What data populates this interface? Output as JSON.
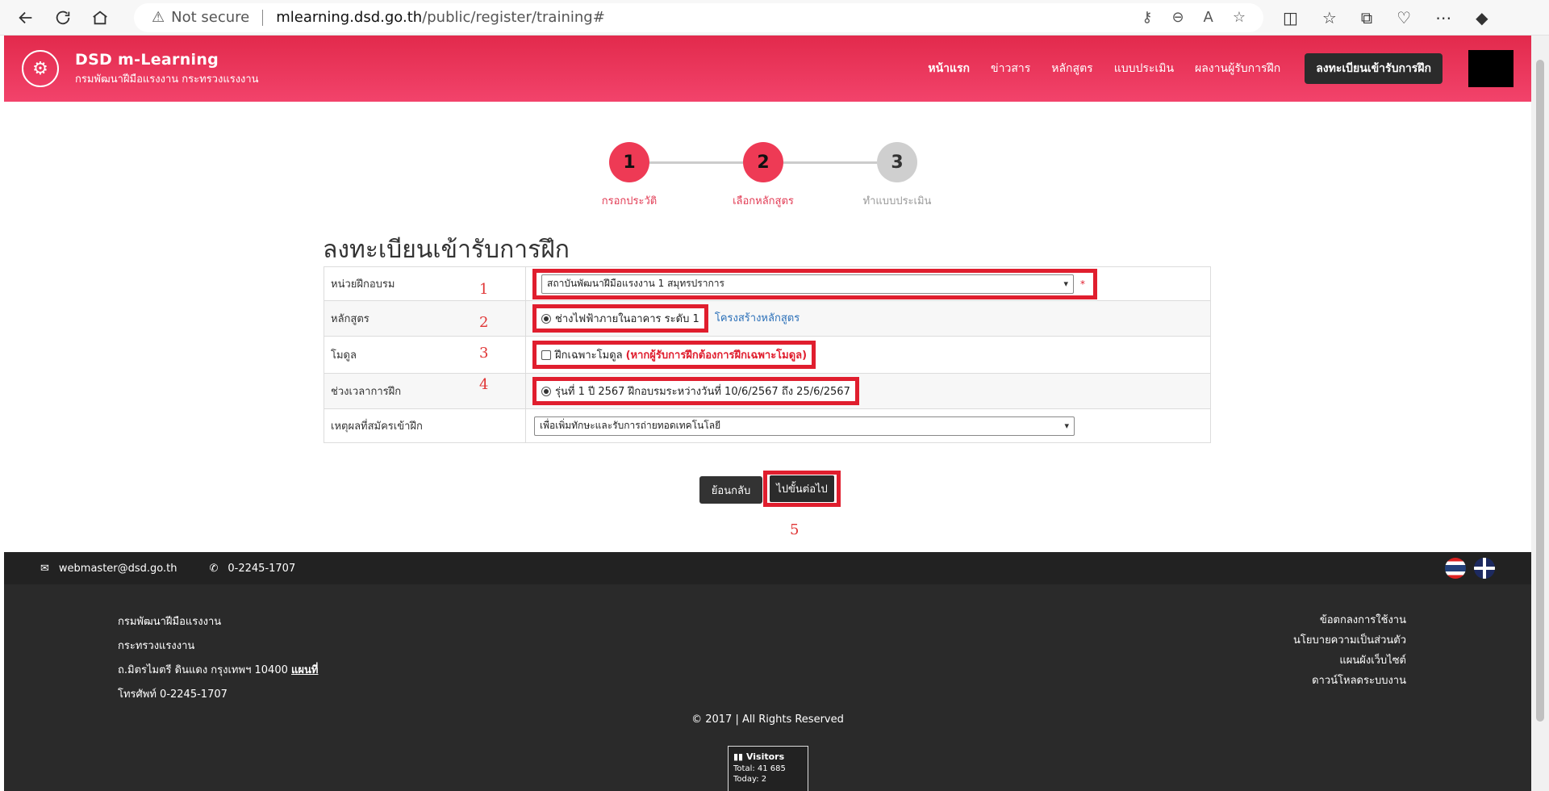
{
  "browser": {
    "security_label": "Not secure",
    "url_host": "mlearning.dsd.go.th",
    "url_path": "/public/register/training#"
  },
  "header": {
    "brand_title": "DSD m-Learning",
    "brand_subtitle": "กรมพัฒนาฝีมือแรงงาน กระทรวงแรงงาน",
    "menu": [
      "หน้าแรก",
      "ข่าวสาร",
      "หลักสูตร",
      "แบบประเมิน",
      "ผลงานผู้รับการฝึก"
    ],
    "register_button": "ลงทะเบียนเข้ารับการฝึก"
  },
  "steps": [
    {
      "number": "1",
      "label": "กรอกประวัติ",
      "state": "done"
    },
    {
      "number": "2",
      "label": "เลือกหลักสูตร",
      "state": "done"
    },
    {
      "number": "3",
      "label": "ทำแบบประเมิน",
      "state": "todo"
    }
  ],
  "form": {
    "title": "ลงทะเบียนเข้ารับการฝึก",
    "rows": {
      "unit_label": "หน่วยฝึกอบรม",
      "unit_value": "สถาบันพัฒนาฝีมือแรงงาน 1 สมุทรปราการ",
      "required_mark": "*",
      "course_label": "หลักสูตร",
      "course_value": "ช่างไฟฟ้าภายในอาคาร ระดับ 1",
      "course_link": "โครงสร้างหลักสูตร",
      "module_label": "โมดูล",
      "module_value": "ฝึกเฉพาะโมดูล",
      "module_note": "(หากผู้รับการฝึกต้องการฝึกเฉพาะโมดูล)",
      "period_label": "ช่วงเวลาการฝึก",
      "period_value": "รุ่นที่ 1 ปี 2567 ฝึกอบรมระหว่างวันที่ 10/6/2567 ถึง 25/6/2567",
      "reason_label": "เหตุผลที่สมัครเข้าฝึก",
      "reason_value": "เพื่อเพิ่มทักษะและรับการถ่ายทอดเทคโนโลยี"
    },
    "annotations": [
      "1",
      "2",
      "3",
      "4",
      "5"
    ],
    "back_button": "ย้อนกลับ",
    "next_button": "ไปขั้นต่อไป"
  },
  "footer": {
    "email": "webmaster@dsd.go.th",
    "phone": "0-2245-1707",
    "org_lines": [
      "กรมพัฒนาฝีมือแรงงาน",
      "กระทรวงแรงงาน",
      "ถ.มิตรไมตรี ดินแดง กรุงเทพฯ 10400",
      "โทรศัพท์ 0-2245-1707"
    ],
    "map_link": "แผนที่",
    "links": [
      "ข้อตกลงการใช้งาน",
      "นโยบายความเป็นส่วนตัว",
      "แผนผังเว็บไซต์",
      "ดาวน์โหลดระบบงาน"
    ],
    "copyright": "© 2017 | All Rights Reserved",
    "visitors": {
      "title": "Visitors",
      "total": "Total: 41 685",
      "today": "Today: 2"
    }
  }
}
